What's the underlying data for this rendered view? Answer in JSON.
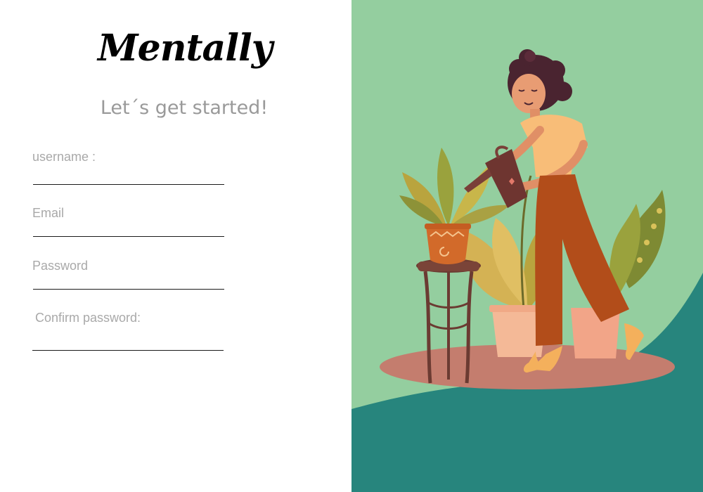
{
  "brand": {
    "name": "Mentally"
  },
  "headline": "Let´s get started!",
  "form": {
    "fields": [
      {
        "label": "username :",
        "value": "",
        "type": "text"
      },
      {
        "label": "Email",
        "value": "",
        "type": "email"
      },
      {
        "label": "Password",
        "value": "",
        "type": "password"
      },
      {
        "label": "Confirm password:",
        "value": "",
        "type": "password"
      }
    ]
  },
  "colors": {
    "illustration_bg": "#94CE9F",
    "teal": "#27857D",
    "floor_shadow": "#C47D6E",
    "label_gray": "#A9A9A9"
  },
  "illustration": {
    "subject": "woman-watering-plants-icon"
  }
}
